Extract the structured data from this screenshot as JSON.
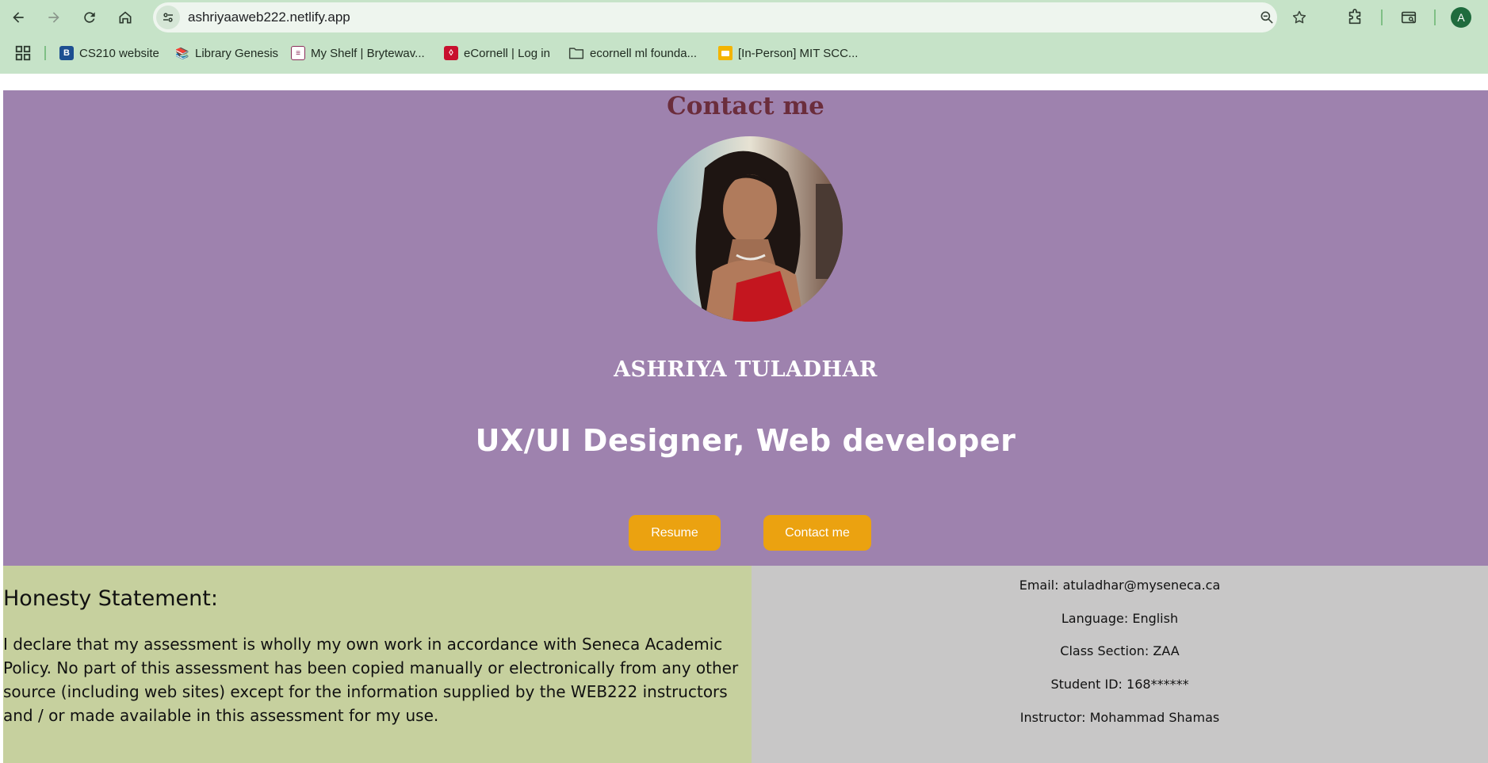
{
  "browser": {
    "url": "ashriyaaweb222.netlify.app",
    "profile_initial": "A",
    "bookmarks": [
      {
        "label": "CS210 website",
        "icon": "cs210-favicon"
      },
      {
        "label": "Library Genesis",
        "icon": "libgen-favicon"
      },
      {
        "label": "My Shelf | Brytewav...",
        "icon": "brytewave-favicon"
      },
      {
        "label": "eCornell | Log in",
        "icon": "ecornell-favicon"
      },
      {
        "label": "ecornell ml founda...",
        "icon": "folder-icon"
      },
      {
        "label": "[In-Person] MIT SCC...",
        "icon": "mit-favicon"
      }
    ]
  },
  "hero": {
    "title": "Contact me",
    "name": "ASHRIYA TULADHAR",
    "role": "UX/UI Designer, Web developer",
    "resume_label": "Resume",
    "contact_label": "Contact me",
    "background_color": "#9e82ae",
    "accent_color": "#eba210"
  },
  "honesty": {
    "heading": "Honesty Statement:",
    "text": "I declare that my assessment is wholly my own work in accordance with Seneca Academic Policy. No part of this assessment has been copied manually or electronically from any other source (including web sites) except for the information supplied by the WEB222 instructors and / or made available in this assessment for my use."
  },
  "info": {
    "email": "Email: atuladhar@myseneca.ca",
    "language": "Language: English",
    "section": "Class Section: ZAA",
    "student_id": "Student ID: 168******",
    "instructor": "Instructor: Mohammad Shamas"
  }
}
